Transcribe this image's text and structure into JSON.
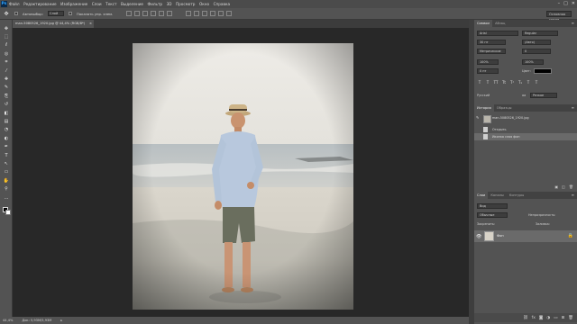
{
  "app": {
    "logo": "Ps"
  },
  "menu": {
    "items": [
      "Файл",
      "Редактирование",
      "Изображение",
      "Слои",
      "Текст",
      "Выделение",
      "Фильтр",
      "3D",
      "Просмотр",
      "Окно",
      "Справка"
    ],
    "window_buttons": [
      "–",
      "□",
      "✕"
    ]
  },
  "options": {
    "auto_select_label": "Автовыбор:",
    "auto_select_value": "Слой",
    "transform_label": "Показать упр. элем.",
    "workspace_value": "Основная среда"
  },
  "document": {
    "tab_title": "man-5080526_1920.jpg @ 44,4% (RGB/8*)",
    "close_symbol": "×"
  },
  "status": {
    "zoom": "44,4%",
    "doc_size": "Док: 5,93M/5,93M",
    "arrow": "▸"
  },
  "tools": {
    "icons": [
      "move-tool-icon",
      "marquee-tool-icon",
      "lasso-tool-icon",
      "quick-select-tool-icon",
      "crop-tool-icon",
      "eyedropper-tool-icon",
      "healing-brush-tool-icon",
      "brush-tool-icon",
      "clone-stamp-tool-icon",
      "history-brush-tool-icon",
      "eraser-tool-icon",
      "gradient-tool-icon",
      "blur-tool-icon",
      "dodge-tool-icon",
      "pen-tool-icon",
      "type-tool-icon",
      "path-select-tool-icon",
      "shape-tool-icon",
      "hand-tool-icon",
      "zoom-tool-icon",
      "extras-tool-icon"
    ],
    "glyphs": [
      "✥",
      "⬚",
      "ℓ",
      "◎",
      "⌗",
      "⁄",
      "✚",
      "✎",
      "⎘",
      "↺",
      "◧",
      "▤",
      "◔",
      "◐",
      "✒",
      "T",
      "↖",
      "▭",
      "✋",
      "⚲",
      "…"
    ]
  },
  "character_panel": {
    "tabs": [
      "Символ",
      "Абзац"
    ],
    "font_family": "Arial",
    "font_style": "Regular",
    "font_size": "30 пт",
    "leading": "(Авто)",
    "kerning": "Метрические",
    "tracking": "0",
    "scale_v": "100%",
    "scale_h": "100%",
    "baseline": "0 пт",
    "color_label": "Цвет:",
    "language": "Русский",
    "aa_label": "aa",
    "aa_value": "Резкое",
    "style_buttons": [
      "T",
      "T",
      "TT",
      "Tt",
      "T¹",
      "T₁",
      "T",
      "T"
    ]
  },
  "history_panel": {
    "tabs": [
      "История",
      "Образцы"
    ],
    "snapshot": "man-5080526_1920.jpg",
    "items": [
      "Открыть",
      "Иконка слоя фон"
    ]
  },
  "layers_panel": {
    "tabs": [
      "Слои",
      "Каналы",
      "Контуры"
    ],
    "filter_label": "Вид",
    "blend_mode": "Обычные",
    "opacity_label": "Непрозрачность:",
    "lock_label": "Закрепить:",
    "fill_label": "Заливка:",
    "layer_name": "Фон",
    "footer_icons": [
      "link-icon",
      "fx-icon",
      "mask-icon",
      "adjustment-icon",
      "folder-icon",
      "new-layer-icon",
      "trash-icon"
    ],
    "footer_glyphs": [
      "⛓",
      "fx",
      "◙",
      "◑",
      "▭",
      "⊞",
      "🗑"
    ]
  },
  "colors": {
    "menubar": "#4b4b4b",
    "panel": "#535353",
    "canvas_bg": "#282828",
    "selected_row": "#6a6a6a"
  }
}
